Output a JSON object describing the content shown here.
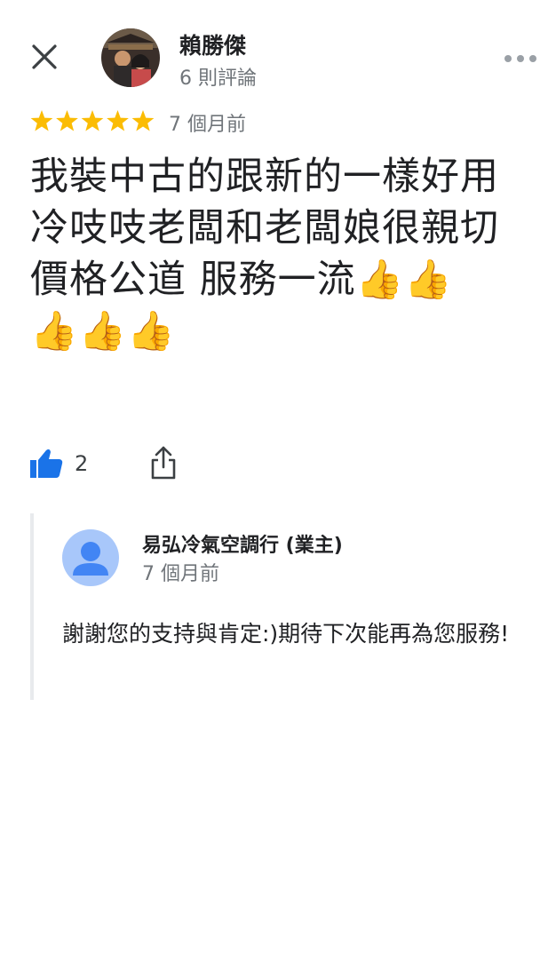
{
  "header": {
    "close_icon": "close-icon",
    "author_name": "賴勝傑",
    "review_count": "6 則評論",
    "more_icon": "more-horizontal-icon"
  },
  "review": {
    "rating": 5,
    "rating_max": 5,
    "star_color": "#fbbc04",
    "time": "7 個月前",
    "text": "我裝中古的跟新的一樣好用 冷吱吱老闆和老闆娘很親切\n價格公道 服務一流👍👍\n👍👍👍"
  },
  "actions": {
    "like_icon": "thumbs-up-icon",
    "like_count": "2",
    "like_color": "#1a73e8",
    "share_icon": "share-icon"
  },
  "owner_reply": {
    "name": "易弘冷氣空調行 (業主)",
    "time": "7 個月前",
    "text": "謝謝您的支持與肯定:)期待下次能再為您服務!",
    "avatar_bg": "#a8c7fa",
    "avatar_fg": "#4285f4"
  }
}
